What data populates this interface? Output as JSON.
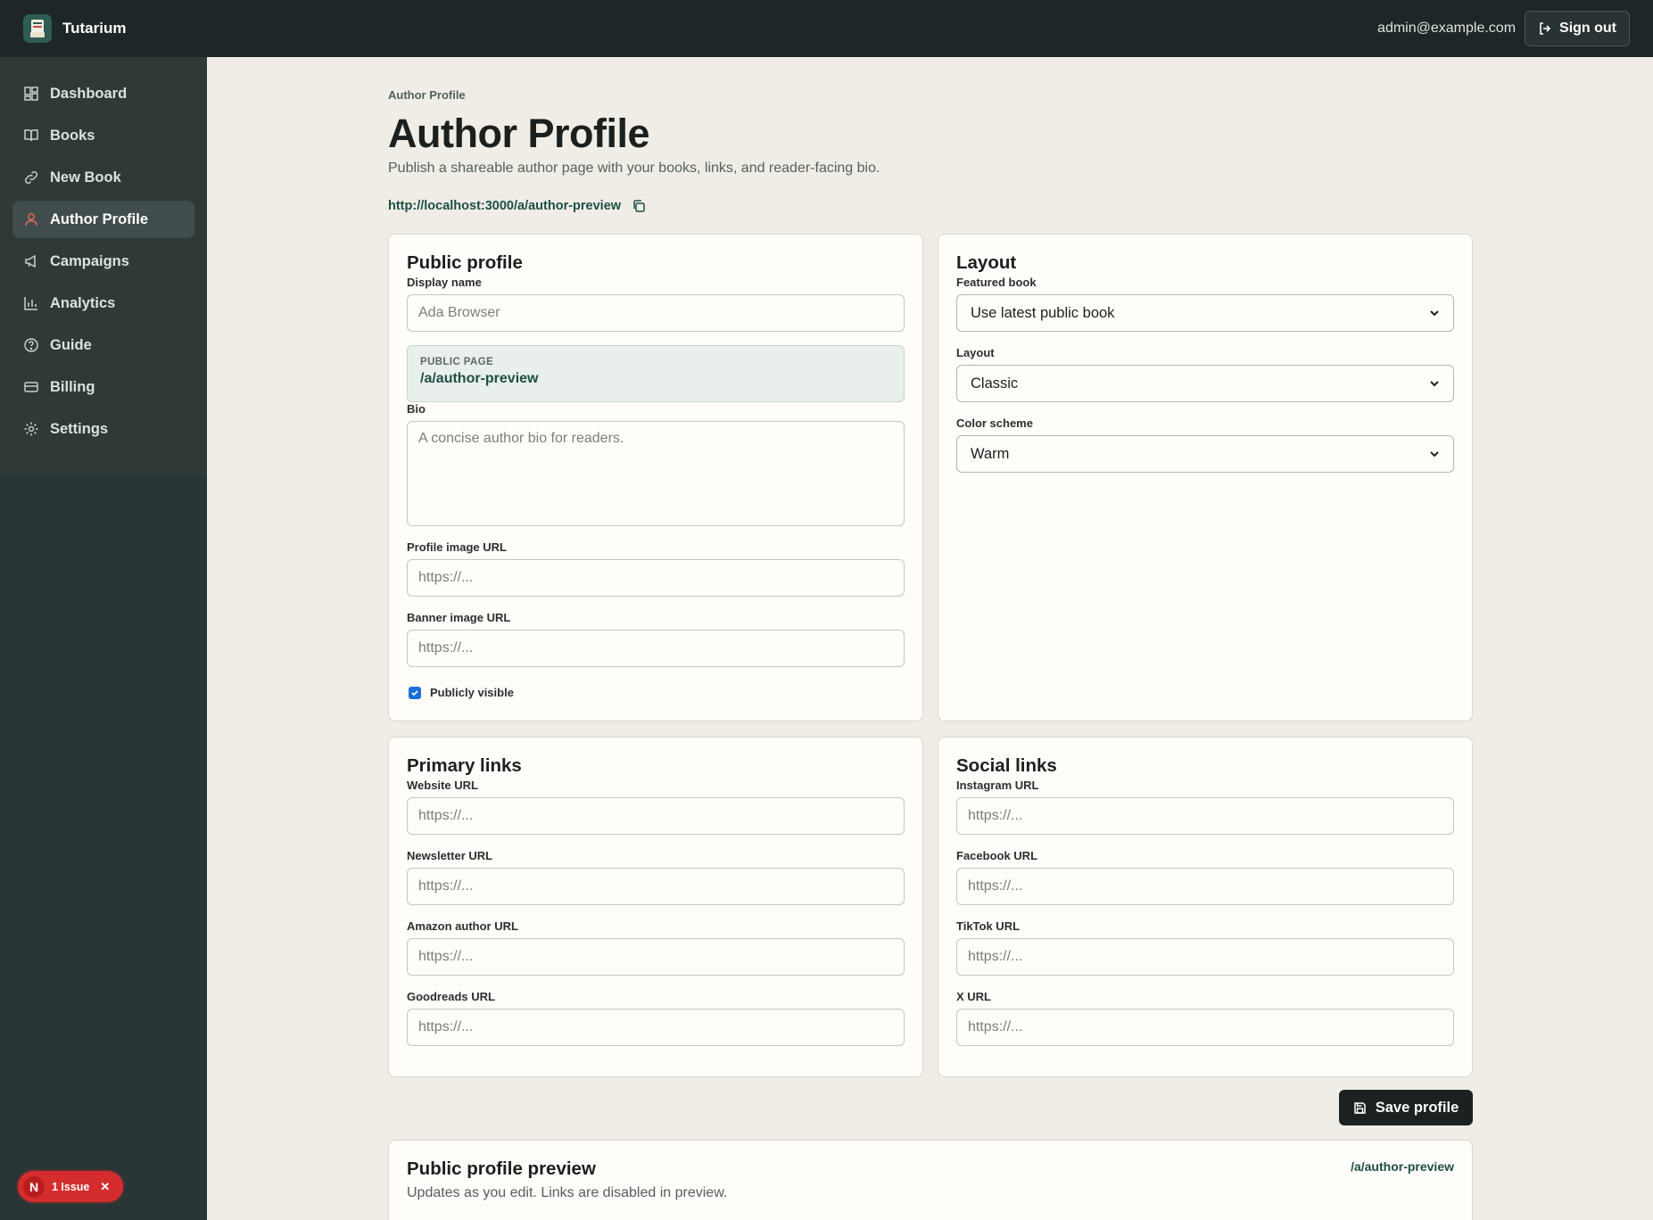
{
  "app": {
    "name": "Tutarium"
  },
  "header": {
    "user_email": "admin@example.com",
    "signout_label": "Sign out"
  },
  "sidebar": {
    "items": [
      {
        "label": "Dashboard",
        "icon": "dashboard-icon"
      },
      {
        "label": "Books",
        "icon": "book-icon"
      },
      {
        "label": "New Book",
        "icon": "link-icon"
      },
      {
        "label": "Author Profile",
        "icon": "user-icon",
        "active": true
      },
      {
        "label": "Campaigns",
        "icon": "megaphone-icon"
      },
      {
        "label": "Analytics",
        "icon": "bar-chart-icon"
      },
      {
        "label": "Guide",
        "icon": "help-circle-icon"
      },
      {
        "label": "Billing",
        "icon": "credit-card-icon"
      },
      {
        "label": "Settings",
        "icon": "gear-icon"
      }
    ]
  },
  "page": {
    "breadcrumb": "Author Profile",
    "title": "Author Profile",
    "subtitle": "Publish a shareable author page with your books, links, and reader-facing bio.",
    "public_url": "http://localhost:3000/a/author-preview"
  },
  "public_profile": {
    "title": "Public profile",
    "display_name_label": "Display name",
    "display_name_placeholder": "Ada Browser",
    "public_page_label": "PUBLIC PAGE",
    "public_page_value": "/a/author-preview",
    "bio_label": "Bio",
    "bio_placeholder": "A concise author bio for readers.",
    "profile_image_label": "Profile image URL",
    "profile_image_placeholder": "https://...",
    "banner_image_label": "Banner image URL",
    "banner_image_placeholder": "https://...",
    "visible_label": "Publicly visible",
    "visible_checked": true
  },
  "layout_card": {
    "title": "Layout",
    "featured_label": "Featured book",
    "featured_value": "Use latest public book",
    "layout_label": "Layout",
    "layout_value": "Classic",
    "color_label": "Color scheme",
    "color_value": "Warm"
  },
  "primary_links": {
    "title": "Primary links",
    "website_label": "Website URL",
    "newsletter_label": "Newsletter URL",
    "amazon_label": "Amazon author URL",
    "goodreads_label": "Goodreads URL",
    "placeholder": "https://..."
  },
  "social_links": {
    "title": "Social links",
    "instagram_label": "Instagram URL",
    "facebook_label": "Facebook URL",
    "tiktok_label": "TikTok URL",
    "x_label": "X URL",
    "placeholder": "https://..."
  },
  "save_label": "Save profile",
  "preview": {
    "title": "Public profile preview",
    "subtitle": "Updates as you edit. Links are disabled in preview.",
    "link": "/a/author-preview"
  },
  "dev_indicator": {
    "letter": "N",
    "label": "1 Issue"
  },
  "colors": {
    "sidebar": "#2a3535",
    "topbar": "#1e2627",
    "accent_green": "#1d4f47",
    "issue_red": "#d52d2d",
    "check_blue": "#1a6ed8"
  }
}
